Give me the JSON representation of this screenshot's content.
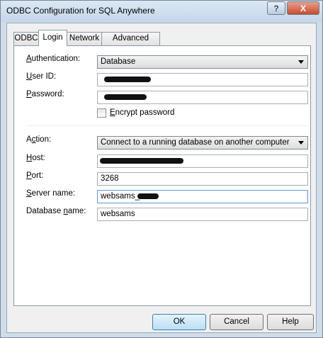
{
  "window": {
    "title": "ODBC Configuration for SQL Anywhere",
    "help_icon": "?",
    "close_icon": "X"
  },
  "tabs": [
    {
      "label": "ODBC",
      "active": false
    },
    {
      "label": "Login",
      "active": true
    },
    {
      "label": "Network",
      "active": false
    },
    {
      "label": "Advanced",
      "active": false
    }
  ],
  "login": {
    "authentication": {
      "label_prefix": "A",
      "label_rest": "uthentication:",
      "value": "Database"
    },
    "user_id": {
      "label_prefix": "U",
      "label_rest": "ser ID:"
    },
    "password": {
      "label_prefix": "P",
      "label_rest": "assword:"
    },
    "encrypt": {
      "label_prefix": "E",
      "label_rest": "ncrypt password",
      "checked": false
    },
    "action": {
      "label_pre": "A",
      "label_u": "c",
      "label_rest": "tion:",
      "value": "Connect to a running database on another computer"
    },
    "host": {
      "label_prefix": "H",
      "label_rest": "ost:"
    },
    "port": {
      "label_prefix": "P",
      "label_rest": "ort:",
      "value": "3268"
    },
    "server_name": {
      "label_prefix": "S",
      "label_rest": "erver name:",
      "value": "websams_"
    },
    "database_name": {
      "label_pre": "Database ",
      "label_u": "n",
      "label_rest": "ame:",
      "value": "websams"
    }
  },
  "buttons": {
    "ok": "OK",
    "cancel": "Cancel",
    "help": "Help"
  }
}
